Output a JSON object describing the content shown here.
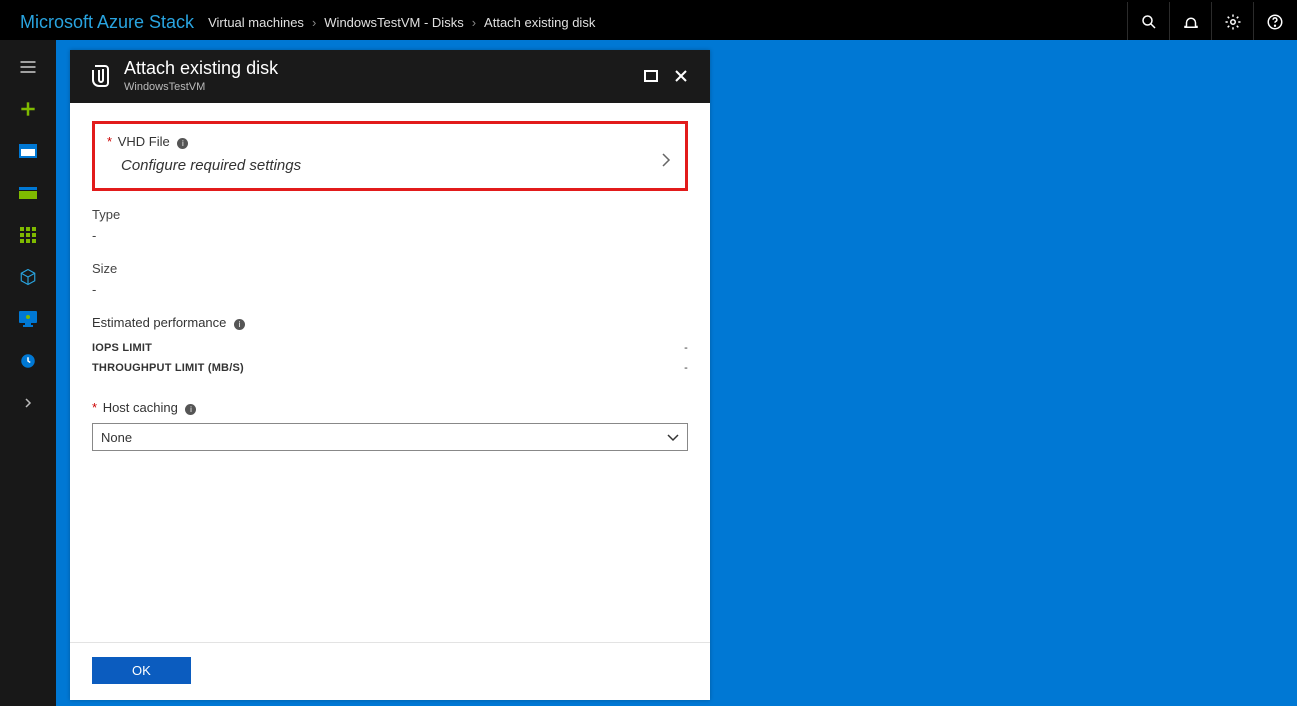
{
  "brand": "Microsoft Azure Stack",
  "breadcrumbs": [
    "Virtual machines",
    "WindowsTestVM - Disks",
    "Attach existing disk"
  ],
  "blade": {
    "title": "Attach existing disk",
    "subtitle": "WindowsTestVM",
    "vhd": {
      "label": "VHD File",
      "placeholder": "Configure required settings"
    },
    "type": {
      "label": "Type",
      "value": "-"
    },
    "size": {
      "label": "Size",
      "value": "-"
    },
    "perf": {
      "label": "Estimated performance",
      "iops_label": "IOPS LIMIT",
      "iops_value": "-",
      "throughput_label": "THROUGHPUT LIMIT (MB/S)",
      "throughput_value": "-"
    },
    "hostcaching": {
      "label": "Host caching",
      "value": "None"
    },
    "ok_label": "OK"
  }
}
